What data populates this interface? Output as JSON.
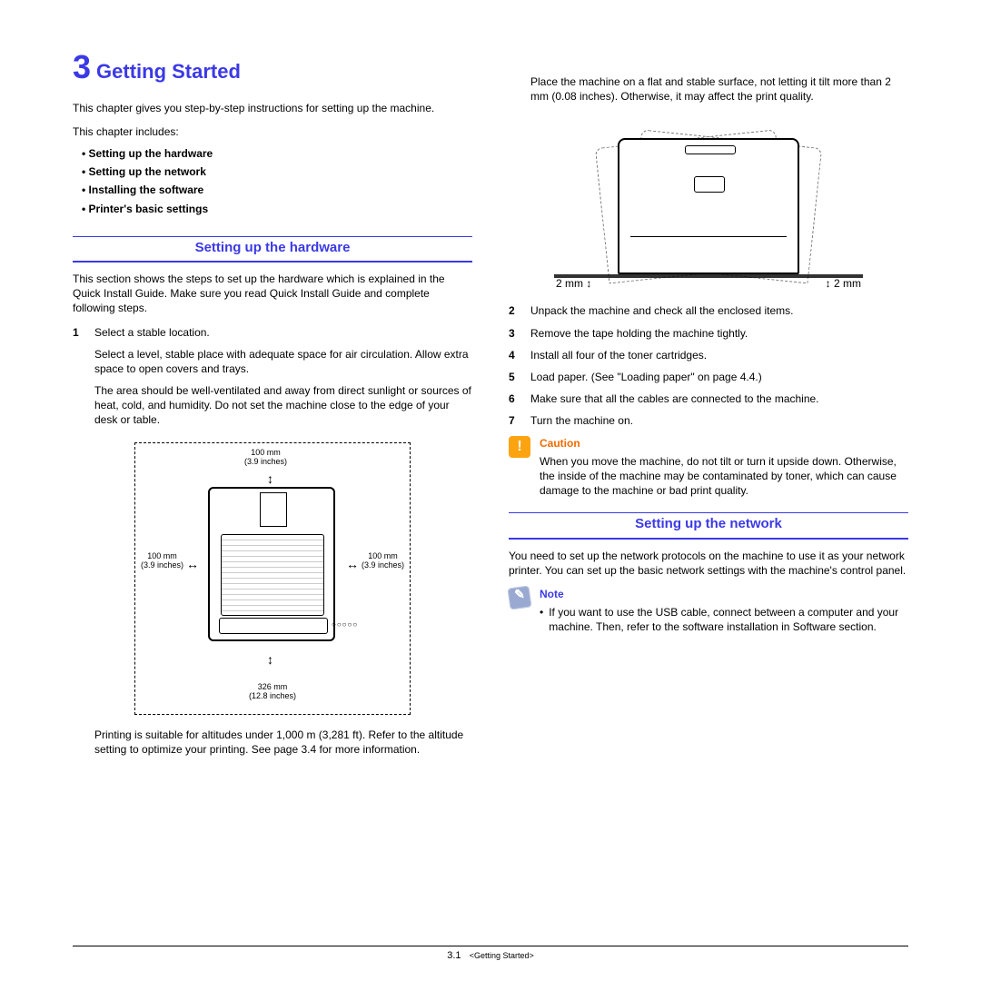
{
  "chapter": {
    "number": "3",
    "title": "Getting Started"
  },
  "intro": "This chapter gives you step-by-step instructions for setting up the machine.",
  "includes_label": "This chapter includes:",
  "toc": [
    "Setting up the hardware",
    "Setting up the network",
    "Installing the software",
    "Printer's basic settings"
  ],
  "hw": {
    "heading": "Setting up the hardware",
    "intro": "This section shows the steps to set up the hardware which is explained in the Quick Install Guide. Make sure you read Quick Install Guide and complete following steps.",
    "step1": {
      "num": "1",
      "line1": "Select a stable location.",
      "line2": "Select a level, stable place with adequate space for air circulation. Allow extra space to open covers and trays.",
      "line3": "The area should be well-ventilated and away from direct sunlight or sources of heat, cold, and humidity. Do not set the machine close to the edge of your desk or table."
    },
    "altitude": "Printing is suitable for altitudes under 1,000 m (3,281 ft). Refer to the altitude setting to optimize your printing. See page 3.4 for more information.",
    "fig1": {
      "top": "100 mm\n(3.9 inches)",
      "left": "100 mm\n(3.9 inches)",
      "right": "100 mm\n(3.9 inches)",
      "bottom": "326 mm\n(12.8 inches)"
    }
  },
  "colR": {
    "tilt": "Place the machine on a flat and stable surface, not letting it tilt more than 2 mm (0.08 inches). Otherwise, it may affect the print quality.",
    "mm_left": "2 mm",
    "mm_right": "2 mm",
    "steps": {
      "s2": {
        "n": "2",
        "t": "Unpack the machine and check all the enclosed items."
      },
      "s3": {
        "n": "3",
        "t": "Remove the tape holding the machine tightly."
      },
      "s4": {
        "n": "4",
        "t": "Install all four of the toner cartridges."
      },
      "s5": {
        "n": "5",
        "t": "Load paper. (See \"Loading paper\" on page 4.4.)"
      },
      "s6": {
        "n": "6",
        "t": "Make sure that all the cables are connected to the machine."
      },
      "s7": {
        "n": "7",
        "t": "Turn the machine on."
      }
    },
    "caution": {
      "title": "Caution",
      "body": "When you move the machine, do not tilt or turn it upside down. Otherwise, the inside of the machine may be contaminated by toner, which can cause damage to the machine or bad print quality."
    }
  },
  "net": {
    "heading": "Setting up the network",
    "intro": "You need to set up the network protocols on the machine to use it as your network printer. You can set up the basic network settings with the machine's control panel.",
    "note": {
      "title": "Note",
      "body": "If you want to use the USB cable, connect between a computer and your machine. Then, refer to the software installation in Software section."
    }
  },
  "footer": {
    "page": "3.1",
    "title": "<Getting Started>"
  }
}
